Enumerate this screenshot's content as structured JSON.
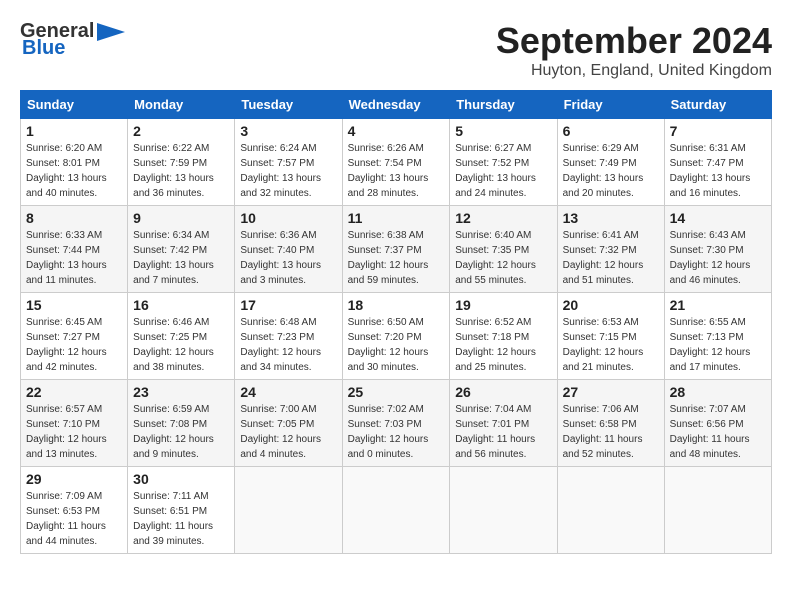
{
  "header": {
    "logo_general": "General",
    "logo_blue": "Blue",
    "title": "September 2024",
    "subtitle": "Huyton, England, United Kingdom"
  },
  "calendar": {
    "weekdays": [
      "Sunday",
      "Monday",
      "Tuesday",
      "Wednesday",
      "Thursday",
      "Friday",
      "Saturday"
    ],
    "weeks": [
      [
        {
          "day": "1",
          "info": "Sunrise: 6:20 AM\nSunset: 8:01 PM\nDaylight: 13 hours\nand 40 minutes."
        },
        {
          "day": "2",
          "info": "Sunrise: 6:22 AM\nSunset: 7:59 PM\nDaylight: 13 hours\nand 36 minutes."
        },
        {
          "day": "3",
          "info": "Sunrise: 6:24 AM\nSunset: 7:57 PM\nDaylight: 13 hours\nand 32 minutes."
        },
        {
          "day": "4",
          "info": "Sunrise: 6:26 AM\nSunset: 7:54 PM\nDaylight: 13 hours\nand 28 minutes."
        },
        {
          "day": "5",
          "info": "Sunrise: 6:27 AM\nSunset: 7:52 PM\nDaylight: 13 hours\nand 24 minutes."
        },
        {
          "day": "6",
          "info": "Sunrise: 6:29 AM\nSunset: 7:49 PM\nDaylight: 13 hours\nand 20 minutes."
        },
        {
          "day": "7",
          "info": "Sunrise: 6:31 AM\nSunset: 7:47 PM\nDaylight: 13 hours\nand 16 minutes."
        }
      ],
      [
        {
          "day": "8",
          "info": "Sunrise: 6:33 AM\nSunset: 7:44 PM\nDaylight: 13 hours\nand 11 minutes."
        },
        {
          "day": "9",
          "info": "Sunrise: 6:34 AM\nSunset: 7:42 PM\nDaylight: 13 hours\nand 7 minutes."
        },
        {
          "day": "10",
          "info": "Sunrise: 6:36 AM\nSunset: 7:40 PM\nDaylight: 13 hours\nand 3 minutes."
        },
        {
          "day": "11",
          "info": "Sunrise: 6:38 AM\nSunset: 7:37 PM\nDaylight: 12 hours\nand 59 minutes."
        },
        {
          "day": "12",
          "info": "Sunrise: 6:40 AM\nSunset: 7:35 PM\nDaylight: 12 hours\nand 55 minutes."
        },
        {
          "day": "13",
          "info": "Sunrise: 6:41 AM\nSunset: 7:32 PM\nDaylight: 12 hours\nand 51 minutes."
        },
        {
          "day": "14",
          "info": "Sunrise: 6:43 AM\nSunset: 7:30 PM\nDaylight: 12 hours\nand 46 minutes."
        }
      ],
      [
        {
          "day": "15",
          "info": "Sunrise: 6:45 AM\nSunset: 7:27 PM\nDaylight: 12 hours\nand 42 minutes."
        },
        {
          "day": "16",
          "info": "Sunrise: 6:46 AM\nSunset: 7:25 PM\nDaylight: 12 hours\nand 38 minutes."
        },
        {
          "day": "17",
          "info": "Sunrise: 6:48 AM\nSunset: 7:23 PM\nDaylight: 12 hours\nand 34 minutes."
        },
        {
          "day": "18",
          "info": "Sunrise: 6:50 AM\nSunset: 7:20 PM\nDaylight: 12 hours\nand 30 minutes."
        },
        {
          "day": "19",
          "info": "Sunrise: 6:52 AM\nSunset: 7:18 PM\nDaylight: 12 hours\nand 25 minutes."
        },
        {
          "day": "20",
          "info": "Sunrise: 6:53 AM\nSunset: 7:15 PM\nDaylight: 12 hours\nand 21 minutes."
        },
        {
          "day": "21",
          "info": "Sunrise: 6:55 AM\nSunset: 7:13 PM\nDaylight: 12 hours\nand 17 minutes."
        }
      ],
      [
        {
          "day": "22",
          "info": "Sunrise: 6:57 AM\nSunset: 7:10 PM\nDaylight: 12 hours\nand 13 minutes."
        },
        {
          "day": "23",
          "info": "Sunrise: 6:59 AM\nSunset: 7:08 PM\nDaylight: 12 hours\nand 9 minutes."
        },
        {
          "day": "24",
          "info": "Sunrise: 7:00 AM\nSunset: 7:05 PM\nDaylight: 12 hours\nand 4 minutes."
        },
        {
          "day": "25",
          "info": "Sunrise: 7:02 AM\nSunset: 7:03 PM\nDaylight: 12 hours\nand 0 minutes."
        },
        {
          "day": "26",
          "info": "Sunrise: 7:04 AM\nSunset: 7:01 PM\nDaylight: 11 hours\nand 56 minutes."
        },
        {
          "day": "27",
          "info": "Sunrise: 7:06 AM\nSunset: 6:58 PM\nDaylight: 11 hours\nand 52 minutes."
        },
        {
          "day": "28",
          "info": "Sunrise: 7:07 AM\nSunset: 6:56 PM\nDaylight: 11 hours\nand 48 minutes."
        }
      ],
      [
        {
          "day": "29",
          "info": "Sunrise: 7:09 AM\nSunset: 6:53 PM\nDaylight: 11 hours\nand 44 minutes."
        },
        {
          "day": "30",
          "info": "Sunrise: 7:11 AM\nSunset: 6:51 PM\nDaylight: 11 hours\nand 39 minutes."
        },
        {
          "day": "",
          "info": ""
        },
        {
          "day": "",
          "info": ""
        },
        {
          "day": "",
          "info": ""
        },
        {
          "day": "",
          "info": ""
        },
        {
          "day": "",
          "info": ""
        }
      ]
    ]
  }
}
